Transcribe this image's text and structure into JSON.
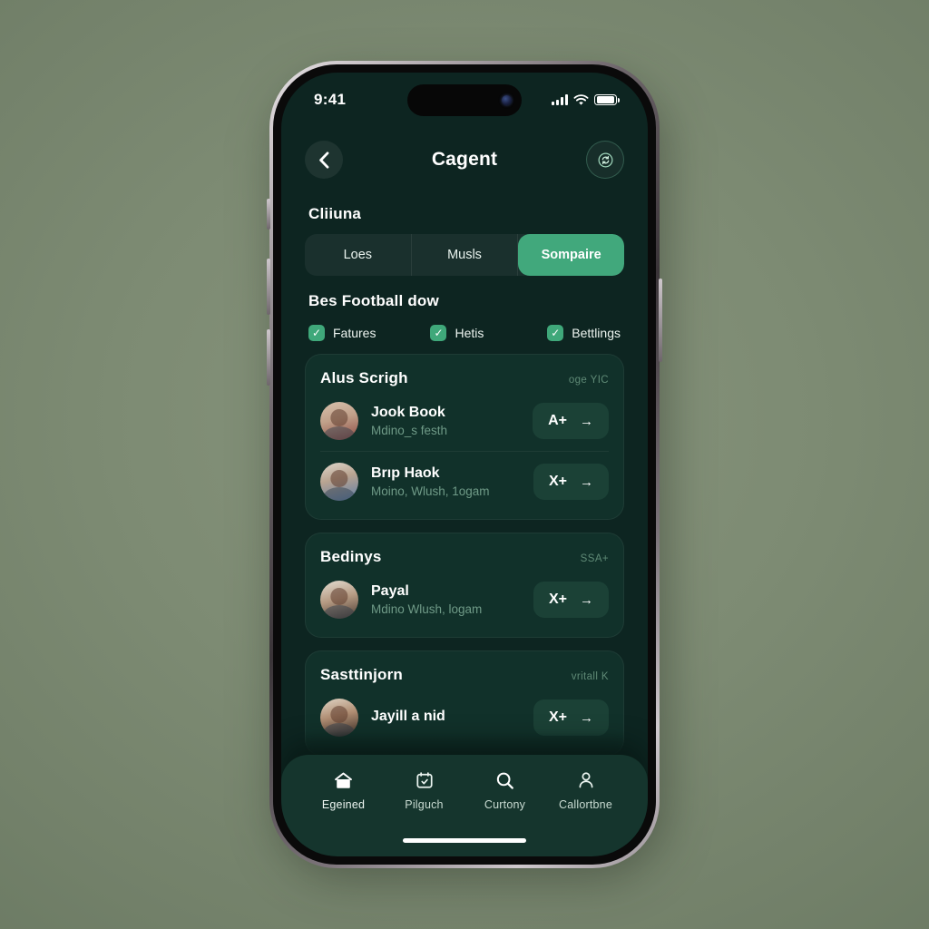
{
  "statusbar": {
    "time": "9:41",
    "signal_icon": "cellular-bars-icon",
    "wifi_icon": "wifi-icon",
    "battery_icon": "battery-icon"
  },
  "navbar": {
    "back_icon": "chevron-left-icon",
    "title": "Cagent",
    "action_icon": "refresh-sync-icon"
  },
  "sections": {
    "segment_label": "Cliiuna",
    "list_label": "Bes Football dow"
  },
  "segment": {
    "options": [
      "Loes",
      "Musls",
      "Sompaire"
    ],
    "selected": "Sompaire"
  },
  "filters": [
    {
      "label": "Fatures",
      "checked": true,
      "icon": "check-icon"
    },
    {
      "label": "Hetis",
      "checked": true,
      "icon": "check-icon"
    },
    {
      "label": "Bettlings",
      "checked": true,
      "icon": "check-icon"
    }
  ],
  "cards": [
    {
      "title": "Alus Scrigh",
      "meta": "oge YIC",
      "rows": [
        {
          "name": "Jook Book",
          "sub": "Mdino_s festh",
          "pill_label": "A+",
          "pill_arrow": "→",
          "avatar": "avatar"
        },
        {
          "name": "Brıp Haok",
          "sub": "Moino, Wlush, 1ogam",
          "pill_label": "X+",
          "pill_arrow": "→",
          "avatar": "avatar"
        }
      ]
    },
    {
      "title": "Bedinys",
      "meta": "SSA+",
      "rows": [
        {
          "name": "Payal",
          "sub": "Mdino Wlush, logam",
          "pill_label": "X+",
          "pill_arrow": "→",
          "avatar": "avatar"
        }
      ]
    },
    {
      "title": "Sasttinjorn",
      "meta": "vritall K",
      "rows": [
        {
          "name": "Jayill a nid",
          "sub": "",
          "pill_label": "X+",
          "pill_arrow": "→",
          "avatar": "avatar"
        }
      ]
    }
  ],
  "tabbar": {
    "items": [
      {
        "label": "Egeined",
        "icon": "home-icon",
        "active": true
      },
      {
        "label": "Pilguch",
        "icon": "calendar-icon",
        "active": false
      },
      {
        "label": "Curtony",
        "icon": "search-icon",
        "active": false
      },
      {
        "label": "Callortbne",
        "icon": "person-icon",
        "active": false
      }
    ]
  },
  "colors": {
    "page_background": "#7f8d75",
    "screen_background": "#0d2521",
    "card_background": "#11312a",
    "accent_green": "#41a87c",
    "pill_background": "#1b4136",
    "muted_text": "#6f9a87"
  }
}
